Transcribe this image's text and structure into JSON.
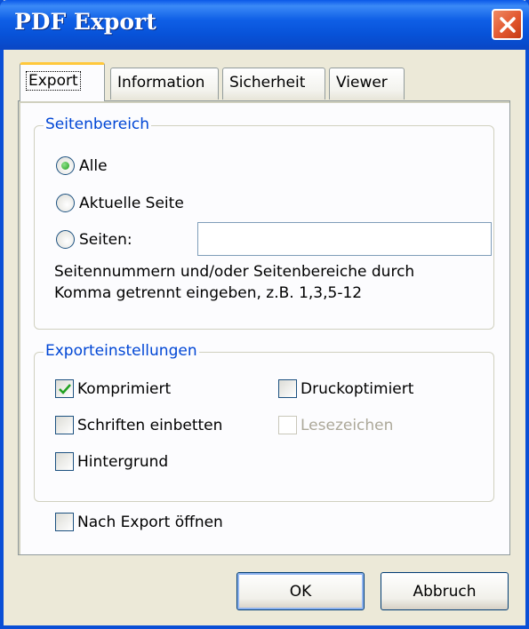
{
  "window": {
    "title": "PDF Export"
  },
  "tabs": [
    {
      "label": "Export",
      "active": true
    },
    {
      "label": "Information",
      "active": false
    },
    {
      "label": "Sicherheit",
      "active": false
    },
    {
      "label": "Viewer",
      "active": false
    }
  ],
  "seitenbereich": {
    "title": "Seitenbereich",
    "options": [
      {
        "label": "Alle",
        "selected": true
      },
      {
        "label": "Aktuelle Seite",
        "selected": false
      },
      {
        "label": "Seiten:",
        "selected": false
      }
    ],
    "pages_value": "",
    "hint_line1": "Seitennummern und/oder Seitenbereiche durch",
    "hint_line2": "Komma getrennt eingeben, z.B. 1,3,5-12"
  },
  "exporteinstellungen": {
    "title": "Exporteinstellungen",
    "komprimiert": {
      "label": "Komprimiert",
      "checked": true
    },
    "druckoptimiert": {
      "label": "Druckoptimiert",
      "checked": false
    },
    "schriften": {
      "label": "Schriften einbetten",
      "checked": false
    },
    "lesezeichen": {
      "label": "Lesezeichen",
      "checked": false,
      "disabled": true
    },
    "hintergrund": {
      "label": "Hintergrund",
      "checked": false
    }
  },
  "nach_export": {
    "label": "Nach Export öffnen",
    "checked": false
  },
  "buttons": {
    "ok": "OK",
    "cancel": "Abbruch"
  },
  "colors": {
    "titlebar": "#0752d8",
    "group_title": "#0046d5",
    "close": "#e2572f"
  }
}
